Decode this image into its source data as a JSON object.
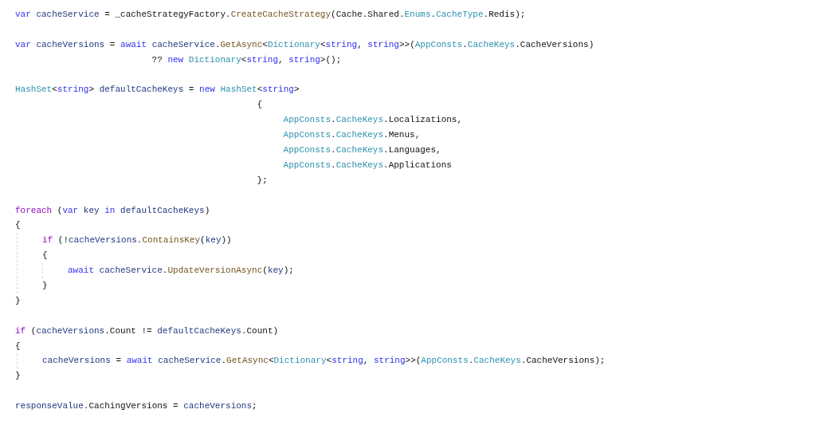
{
  "editor": {
    "lines": [
      {
        "kind": "code",
        "tokens": [
          {
            "kind": "keyword",
            "text": "var "
          },
          {
            "kind": "variable",
            "text": "cacheService"
          },
          {
            "kind": "plain",
            "text": " = _cacheStrategyFactory."
          },
          {
            "kind": "method",
            "text": "CreateCacheStrategy"
          },
          {
            "kind": "plain",
            "text": "(Cache.Shared."
          },
          {
            "kind": "type",
            "text": "Enums"
          },
          {
            "kind": "plain",
            "text": "."
          },
          {
            "kind": "type",
            "text": "CacheType"
          },
          {
            "kind": "plain",
            "text": ".Redis);"
          }
        ]
      },
      {
        "kind": "blank"
      },
      {
        "kind": "code",
        "tokens": [
          {
            "kind": "keyword",
            "text": "var "
          },
          {
            "kind": "variable",
            "text": "cacheVersions"
          },
          {
            "kind": "plain",
            "text": " = "
          },
          {
            "kind": "keyword",
            "text": "await "
          },
          {
            "kind": "variable",
            "text": "cacheService"
          },
          {
            "kind": "plain",
            "text": "."
          },
          {
            "kind": "method",
            "text": "GetAsync"
          },
          {
            "kind": "plain",
            "text": "<"
          },
          {
            "kind": "type",
            "text": "Dictionary"
          },
          {
            "kind": "plain",
            "text": "<"
          },
          {
            "kind": "keyword",
            "text": "string"
          },
          {
            "kind": "plain",
            "text": ", "
          },
          {
            "kind": "keyword",
            "text": "string"
          },
          {
            "kind": "plain",
            "text": ">>("
          },
          {
            "kind": "type",
            "text": "AppConsts"
          },
          {
            "kind": "plain",
            "text": "."
          },
          {
            "kind": "type",
            "text": "CacheKeys"
          },
          {
            "kind": "plain",
            "text": ".CacheVersions)"
          }
        ]
      },
      {
        "kind": "continuation",
        "tokens": [
          {
            "kind": "plain",
            "text": "?? "
          },
          {
            "kind": "keyword",
            "text": "new "
          },
          {
            "kind": "type",
            "text": "Dictionary"
          },
          {
            "kind": "plain",
            "text": "<"
          },
          {
            "kind": "keyword",
            "text": "string"
          },
          {
            "kind": "plain",
            "text": ", "
          },
          {
            "kind": "keyword",
            "text": "string"
          },
          {
            "kind": "plain",
            "text": ">();"
          }
        ]
      },
      {
        "kind": "blank"
      },
      {
        "kind": "code",
        "tokens": [
          {
            "kind": "type",
            "text": "HashSet"
          },
          {
            "kind": "plain",
            "text": "<"
          },
          {
            "kind": "keyword",
            "text": "string"
          },
          {
            "kind": "plain",
            "text": "> "
          },
          {
            "kind": "variable",
            "text": "defaultCacheKeys"
          },
          {
            "kind": "plain",
            "text": " = "
          },
          {
            "kind": "keyword",
            "text": "new "
          },
          {
            "kind": "type",
            "text": "HashSet"
          },
          {
            "kind": "plain",
            "text": "<"
          },
          {
            "kind": "keyword",
            "text": "string"
          },
          {
            "kind": "plain",
            "text": ">"
          }
        ]
      },
      {
        "kind": "initializer_brace",
        "tokens": [
          {
            "kind": "plain",
            "text": "{"
          }
        ]
      },
      {
        "kind": "initializer_item",
        "tokens": [
          {
            "kind": "type",
            "text": "AppConsts"
          },
          {
            "kind": "plain",
            "text": "."
          },
          {
            "kind": "type",
            "text": "CacheKeys"
          },
          {
            "kind": "plain",
            "text": ".Localizations,"
          }
        ]
      },
      {
        "kind": "initializer_item",
        "tokens": [
          {
            "kind": "type",
            "text": "AppConsts"
          },
          {
            "kind": "plain",
            "text": "."
          },
          {
            "kind": "type",
            "text": "CacheKeys"
          },
          {
            "kind": "plain",
            "text": ".Menus,"
          }
        ]
      },
      {
        "kind": "initializer_item",
        "tokens": [
          {
            "kind": "type",
            "text": "AppConsts"
          },
          {
            "kind": "plain",
            "text": "."
          },
          {
            "kind": "type",
            "text": "CacheKeys"
          },
          {
            "kind": "plain",
            "text": ".Languages,"
          }
        ]
      },
      {
        "kind": "initializer_item",
        "tokens": [
          {
            "kind": "type",
            "text": "AppConsts"
          },
          {
            "kind": "plain",
            "text": "."
          },
          {
            "kind": "type",
            "text": "CacheKeys"
          },
          {
            "kind": "plain",
            "text": ".Applications"
          }
        ]
      },
      {
        "kind": "initializer_brace",
        "tokens": [
          {
            "kind": "plain",
            "text": "};"
          }
        ]
      },
      {
        "kind": "blank"
      },
      {
        "kind": "code",
        "tokens": [
          {
            "kind": "control",
            "text": "foreach"
          },
          {
            "kind": "plain",
            "text": " ("
          },
          {
            "kind": "keyword",
            "text": "var "
          },
          {
            "kind": "variable",
            "text": "key"
          },
          {
            "kind": "keyword",
            "text": " in "
          },
          {
            "kind": "variable",
            "text": "defaultCacheKeys"
          },
          {
            "kind": "plain",
            "text": ")"
          }
        ]
      },
      {
        "kind": "code",
        "tokens": [
          {
            "kind": "plain",
            "text": "{"
          }
        ],
        "children": [
          {
            "kind": "code",
            "tokens": [
              {
                "kind": "control",
                "text": "if"
              },
              {
                "kind": "plain",
                "text": " (!"
              },
              {
                "kind": "variable",
                "text": "cacheVersions"
              },
              {
                "kind": "plain",
                "text": "."
              },
              {
                "kind": "method",
                "text": "ContainsKey"
              },
              {
                "kind": "plain",
                "text": "("
              },
              {
                "kind": "variable",
                "text": "key"
              },
              {
                "kind": "plain",
                "text": "))"
              }
            ]
          },
          {
            "kind": "code",
            "tokens": [
              {
                "kind": "plain",
                "text": "{"
              }
            ],
            "children": [
              {
                "kind": "code",
                "tokens": [
                  {
                    "kind": "keyword",
                    "text": "await "
                  },
                  {
                    "kind": "variable",
                    "text": "cacheService"
                  },
                  {
                    "kind": "plain",
                    "text": "."
                  },
                  {
                    "kind": "method",
                    "text": "UpdateVersionAsync"
                  },
                  {
                    "kind": "plain",
                    "text": "("
                  },
                  {
                    "kind": "variable",
                    "text": "key"
                  },
                  {
                    "kind": "plain",
                    "text": ");"
                  }
                ]
              }
            ]
          },
          {
            "kind": "code",
            "tokens": [
              {
                "kind": "plain",
                "text": "}"
              }
            ]
          }
        ]
      },
      {
        "kind": "code",
        "tokens": [
          {
            "kind": "plain",
            "text": "}"
          }
        ]
      },
      {
        "kind": "blank"
      },
      {
        "kind": "code",
        "tokens": [
          {
            "kind": "control",
            "text": "if"
          },
          {
            "kind": "plain",
            "text": " ("
          },
          {
            "kind": "variable",
            "text": "cacheVersions"
          },
          {
            "kind": "plain",
            "text": ".Count != "
          },
          {
            "kind": "variable",
            "text": "defaultCacheKeys"
          },
          {
            "kind": "plain",
            "text": ".Count)"
          }
        ]
      },
      {
        "kind": "code",
        "tokens": [
          {
            "kind": "plain",
            "text": "{"
          }
        ],
        "children": [
          {
            "kind": "code",
            "tokens": [
              {
                "kind": "variable",
                "text": "cacheVersions"
              },
              {
                "kind": "plain",
                "text": " = "
              },
              {
                "kind": "keyword",
                "text": "await "
              },
              {
                "kind": "variable",
                "text": "cacheService"
              },
              {
                "kind": "plain",
                "text": "."
              },
              {
                "kind": "method",
                "text": "GetAsync"
              },
              {
                "kind": "plain",
                "text": "<"
              },
              {
                "kind": "type",
                "text": "Dictionary"
              },
              {
                "kind": "plain",
                "text": "<"
              },
              {
                "kind": "keyword",
                "text": "string"
              },
              {
                "kind": "plain",
                "text": ", "
              },
              {
                "kind": "keyword",
                "text": "string"
              },
              {
                "kind": "plain",
                "text": ">>("
              },
              {
                "kind": "type",
                "text": "AppConsts"
              },
              {
                "kind": "plain",
                "text": "."
              },
              {
                "kind": "type",
                "text": "CacheKeys"
              },
              {
                "kind": "plain",
                "text": ".CacheVersions);"
              }
            ]
          }
        ]
      },
      {
        "kind": "code",
        "tokens": [
          {
            "kind": "plain",
            "text": "}"
          }
        ]
      },
      {
        "kind": "blank"
      },
      {
        "kind": "code",
        "tokens": [
          {
            "kind": "variable",
            "text": "responseValue"
          },
          {
            "kind": "plain",
            "text": ".CachingVersions = "
          },
          {
            "kind": "variable",
            "text": "cacheVersions"
          },
          {
            "kind": "plain",
            "text": ";"
          }
        ]
      }
    ]
  }
}
